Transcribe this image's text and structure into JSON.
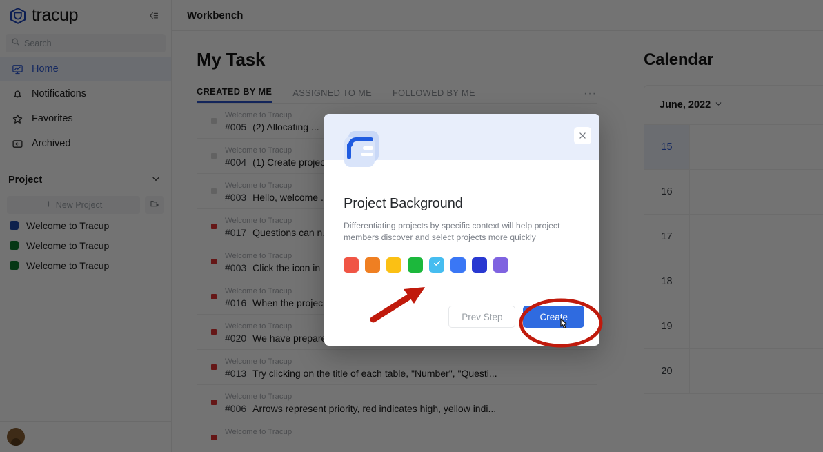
{
  "brand": {
    "name": "tracup",
    "logo_icon": "tracup-cube-logo",
    "collapse_icon": "sidebar-collapse-icon"
  },
  "search": {
    "placeholder": "Search",
    "icon": "search-icon"
  },
  "sidebar": {
    "nav": [
      {
        "label": "Home",
        "icon": "dashboard-icon",
        "active": true
      },
      {
        "label": "Notifications",
        "icon": "bell-icon",
        "active": false
      },
      {
        "label": "Favorites",
        "icon": "star-icon",
        "active": false
      },
      {
        "label": "Archived",
        "icon": "archive-box-icon",
        "active": false
      }
    ],
    "project_section": {
      "label": "Project",
      "chevron_icon": "chevron-down-icon",
      "new_project_label": "New Project",
      "new_project_icon": "plus-icon",
      "new_folder_icon": "new-folder-icon",
      "projects": [
        {
          "label": "Welcome to Tracup",
          "color": "#1f49a8"
        },
        {
          "label": "Welcome to Tracup",
          "color": "#0f7a2e"
        },
        {
          "label": "Welcome to Tracup",
          "color": "#0f7a2e"
        }
      ]
    },
    "avatar_name": "user-avatar"
  },
  "header": {
    "title": "Workbench"
  },
  "main": {
    "page_title": "My Task",
    "tabs": [
      {
        "label": "CREATED BY ME",
        "active": true
      },
      {
        "label": "ASSIGNED TO ME",
        "active": false
      },
      {
        "label": "FOLLOWED BY ME",
        "active": false
      }
    ],
    "more_label": "···",
    "tasks": [
      {
        "project": "Welcome to Tracup",
        "id": "#005",
        "title": "(2)  Allocating ...",
        "priority": "normal"
      },
      {
        "project": "Welcome to Tracup",
        "id": "#004",
        "title": "(1) Create projec...",
        "priority": "normal"
      },
      {
        "project": "Welcome to Tracup",
        "id": "#003",
        "title": "Hello, welcome ...",
        "priority": "normal"
      },
      {
        "project": "Welcome to Tracup",
        "id": "#017",
        "title": "Questions can n...",
        "priority": "high"
      },
      {
        "project": "Welcome to Tracup",
        "id": "#003",
        "title": "Click the icon in ...",
        "priority": "high"
      },
      {
        "project": "Welcome to Tracup",
        "id": "#016",
        "title": "When the projec...",
        "priority": "high"
      },
      {
        "project": "Welcome to Tracup",
        "id": "#020",
        "title": "We have prepared a beautiful statistical system for you, ...",
        "priority": "high"
      },
      {
        "project": "Welcome to Tracup",
        "id": "#013",
        "title": "Try clicking on the title of each table, \"Number\", \"Questi...",
        "priority": "high"
      },
      {
        "project": "Welcome to Tracup",
        "id": "#006",
        "title": "Arrows represent priority, red indicates high, yellow indi...",
        "priority": "high"
      },
      {
        "project": "Welcome to Tracup",
        "id": "",
        "title": "",
        "priority": "high"
      }
    ]
  },
  "calendar": {
    "title": "Calendar",
    "month": "June, 2022",
    "chevron_icon": "chevron-down-icon",
    "days": [
      {
        "day": "15",
        "today": true
      },
      {
        "day": "16",
        "today": false
      },
      {
        "day": "17",
        "today": false
      },
      {
        "day": "18",
        "today": false
      },
      {
        "day": "19",
        "today": false
      },
      {
        "day": "20",
        "today": false
      }
    ]
  },
  "modal": {
    "icon": "project-book-icon",
    "close_icon": "close-icon",
    "heading": "Project Background",
    "description": "Differentiating projects by specific context will help project members discover and select projects more quickly",
    "colors": [
      {
        "hex": "#f05545",
        "selected": false
      },
      {
        "hex": "#ef7f22",
        "selected": false
      },
      {
        "hex": "#fbc014",
        "selected": false
      },
      {
        "hex": "#1cb83c",
        "selected": false
      },
      {
        "hex": "#46bdf0",
        "selected": true
      },
      {
        "hex": "#3a77f5",
        "selected": false
      },
      {
        "hex": "#2938d1",
        "selected": false
      },
      {
        "hex": "#7f63e0",
        "selected": false
      }
    ],
    "check_icon": "check-icon",
    "prev_label": "Prev Step",
    "create_label": "Create"
  },
  "annotations": {
    "arrow_color": "#c01a0c",
    "ellipse_color": "#c01a0c",
    "arrow_name": "red-arrow-annotation",
    "ellipse_name": "red-ellipse-annotation",
    "cursor_name": "mouse-cursor"
  }
}
